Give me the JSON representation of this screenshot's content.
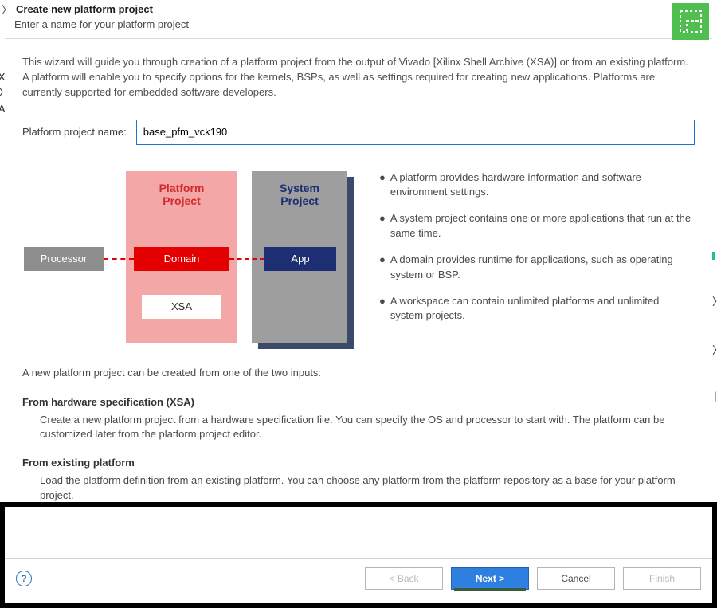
{
  "header": {
    "title": "Create new platform project",
    "subtitle": "Enter a name for your platform project"
  },
  "description": "This wizard will guide you through creation of a platform project from the output of Vivado [Xilinx Shell Archive (XSA)] or from an existing platform. A platform will enable you to specify options for the kernels, BSPs, as well as settings required for creating new applications. Platforms are currently supported for embedded software developers.",
  "name_field": {
    "label": "Platform project name:",
    "value": "base_pfm_vck190"
  },
  "diagram": {
    "processor": "Processor",
    "platform_title_l1": "Platform",
    "platform_title_l2": "Project",
    "domain": "Domain",
    "xsa": "XSA",
    "system_title_l1": "System",
    "system_title_l2": "Project",
    "app": "App"
  },
  "bullets": [
    "A platform provides hardware information and software environment settings.",
    "A system project contains one or more applications that run at the same time.",
    "A domain provides runtime for applications, such as operating system or BSP.",
    "A workspace can contain unlimited platforms and unlimited system projects."
  ],
  "inputs_intro": "A new platform project can be created from one of the two inputs:",
  "sections": [
    {
      "heading": "From hardware specification (XSA)",
      "body": "Create a new platform project from a hardware specification file. You can specify the OS and processor to start with. The platform can be customized later from the platform project editor."
    },
    {
      "heading": "From existing platform",
      "body": "Load the platform definition from an existing platform. You can choose any platform from the platform repository as a base for your platform project."
    }
  ],
  "buttons": {
    "back": "< Back",
    "next": "Next >",
    "cancel": "Cancel",
    "finish": "Finish"
  }
}
